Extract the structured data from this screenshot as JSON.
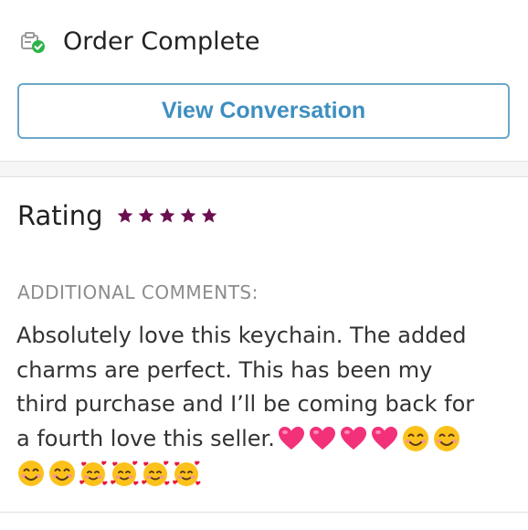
{
  "header": {
    "title": "Order Complete",
    "icon": "order-complete-icon"
  },
  "view_conversation": {
    "label": "View Conversation"
  },
  "rating": {
    "label": "Rating",
    "stars": 5,
    "max_stars": 5,
    "star_color": "#6b0f4f"
  },
  "comments": {
    "label": "ADDITIONAL COMMENTS:",
    "lines": [
      "Absolutely love this keychain. The added",
      "charms are perfect. This has been my",
      "third purchase and I’ll be coming back for",
      "a fourth love this seller."
    ],
    "emojis": [
      "pink-heart-emoji",
      "pink-heart-emoji",
      "pink-heart-emoji",
      "pink-heart-emoji",
      "smiling-face-emoji",
      "smiling-face-emoji",
      "smiling-face-emoji",
      "smiling-face-emoji",
      "smiling-face-with-hearts-emoji",
      "smiling-face-with-hearts-emoji",
      "smiling-face-with-hearts-emoji",
      "smiling-face-with-hearts-emoji"
    ]
  },
  "colors": {
    "accent": "#3e8fc0",
    "button_border": "#6ba7c8",
    "check_green": "#2eb34a",
    "muted_label": "#8c8c8c"
  }
}
